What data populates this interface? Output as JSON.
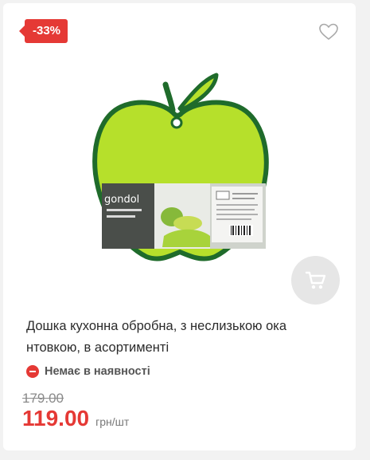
{
  "product": {
    "discount_badge": "-33%",
    "title": "Дошка кухонна обробна, з неслизькою ока нтовкою, в асортименті",
    "stock_status": "Немає в наявності",
    "old_price": "179.00",
    "price": "119.00",
    "unit": "грн/шт",
    "image_brand_text": "gondol"
  },
  "icons": {
    "wishlist": "heart-outline-icon",
    "cart": "shopping-cart-icon",
    "stock": "minus-circle-icon"
  },
  "colors": {
    "accent": "#e53935",
    "card_background": "#ffffff",
    "page_background": "#f2f2f2",
    "cart_button_bg": "#e6e6e6",
    "apple_green": "#b6e02b",
    "apple_border": "#1f6b2b"
  }
}
